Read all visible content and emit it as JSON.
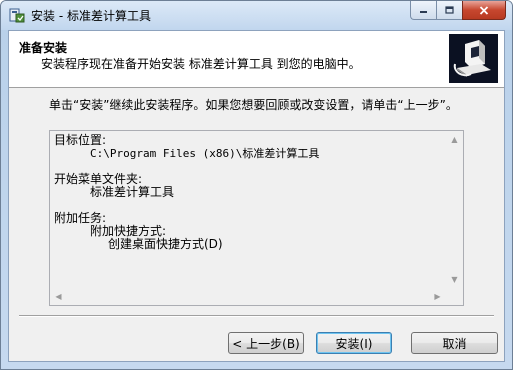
{
  "window": {
    "title": "安装 - 标准差计算工具"
  },
  "header": {
    "title": "准备安装",
    "subtitle": "安装程序现在准备开始安装 标准差计算工具 到您的电脑中。"
  },
  "body": {
    "instruction": "单击“安装”继续此安装程序。如果您想要回顾或改变设置，请单击“上一步”。"
  },
  "memo": {
    "dest_label": "目标位置:",
    "dest_value": "C:\\Program Files (x86)\\标准差计算工具",
    "startmenu_label": "开始菜单文件夹:",
    "startmenu_value": "标准差计算工具",
    "tasks_label": "附加任务:",
    "tasks_group": "附加快捷方式:",
    "tasks_item": "创建桌面快捷方式(D)"
  },
  "buttons": {
    "back": "< 上一步(B)",
    "install": "安装(I)",
    "cancel": "取消"
  }
}
